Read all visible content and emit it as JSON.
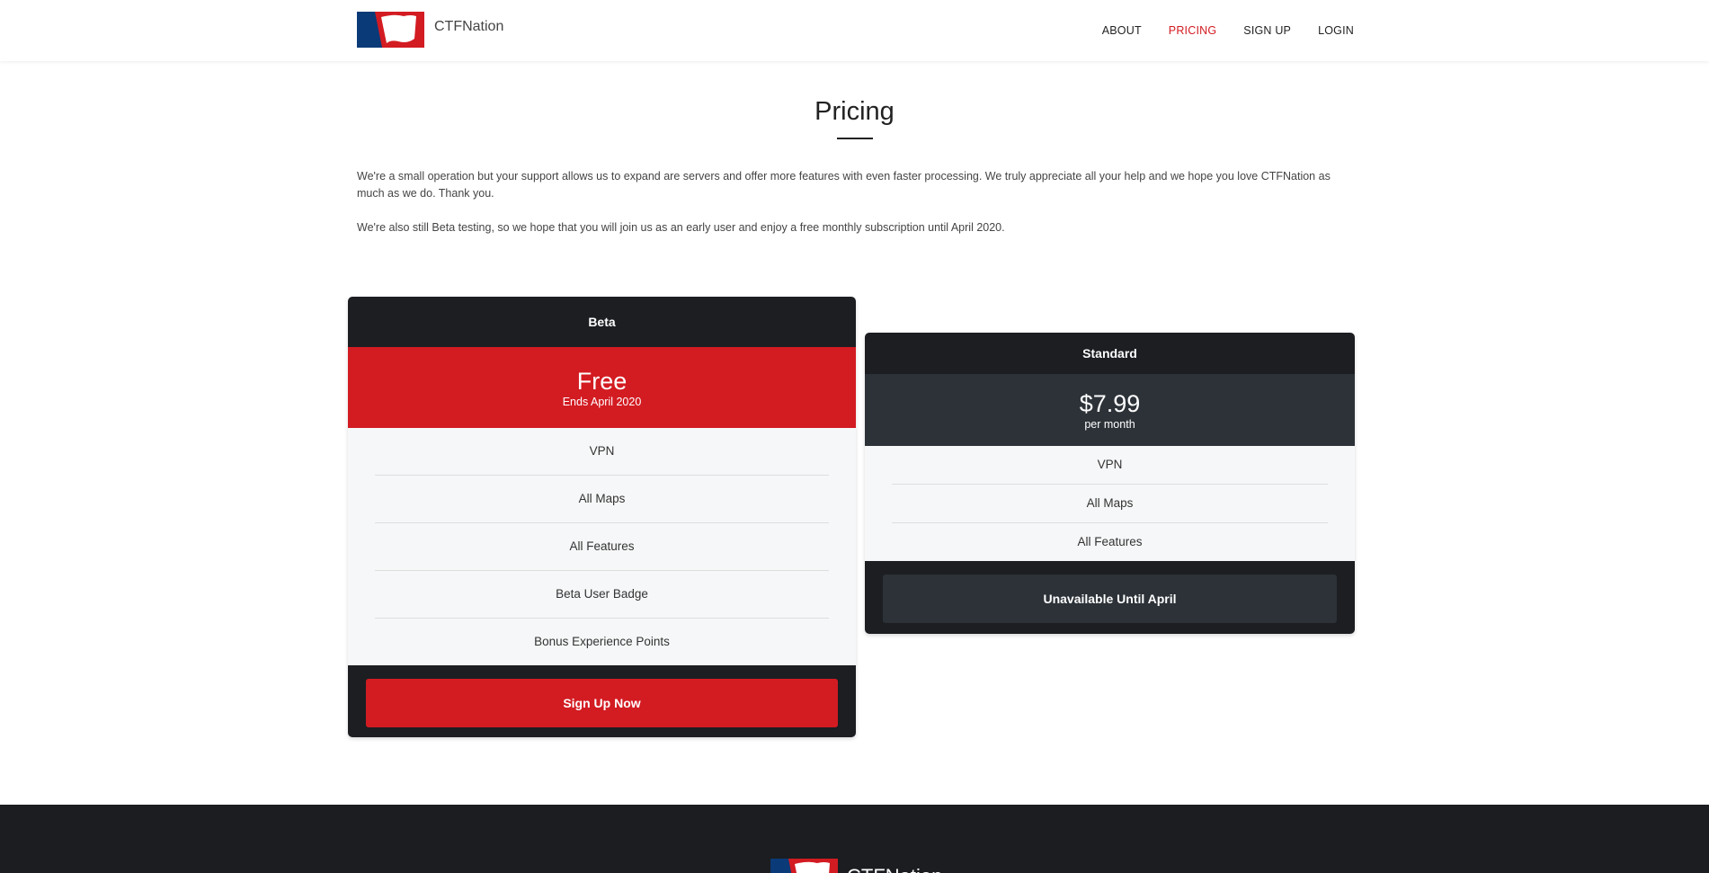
{
  "header": {
    "brand": "CTFNation",
    "nav": [
      {
        "label": "ABOUT",
        "active": false
      },
      {
        "label": "PRICING",
        "active": true
      },
      {
        "label": "SIGN UP",
        "active": false
      },
      {
        "label": "LOGIN",
        "active": false
      }
    ]
  },
  "main": {
    "title": "Pricing",
    "paragraphs": [
      "We're a small operation but your support allows us to expand are servers and offer more features with even faster processing. We truly appreciate all your help and we hope you love CTFNation as much as we do. Thank you.",
      "We're also still Beta testing, so we hope that you will join us as an early user and enjoy a free monthly subscription until April 2020."
    ]
  },
  "plans": [
    {
      "name": "Beta",
      "price": "Free",
      "price_note": "Ends April 2020",
      "features": [
        "VPN",
        "All Maps",
        "All Features",
        "Beta User Badge",
        "Bonus Experience Points"
      ],
      "button": "Sign Up Now",
      "accent": "#d31b22"
    },
    {
      "name": "Standard",
      "price": "$7.99",
      "price_note": "per month",
      "features": [
        "VPN",
        "All Maps",
        "All Features"
      ],
      "button": "Unavailable Until April",
      "accent": "#2c3238"
    }
  ],
  "footer": {
    "brand": "CTFNation"
  },
  "colors": {
    "brand_red": "#d31b22",
    "brand_blue": "#0a3a78",
    "dark": "#1c1e22"
  },
  "icons": {
    "logo": "ctfnation-flag-logo"
  }
}
